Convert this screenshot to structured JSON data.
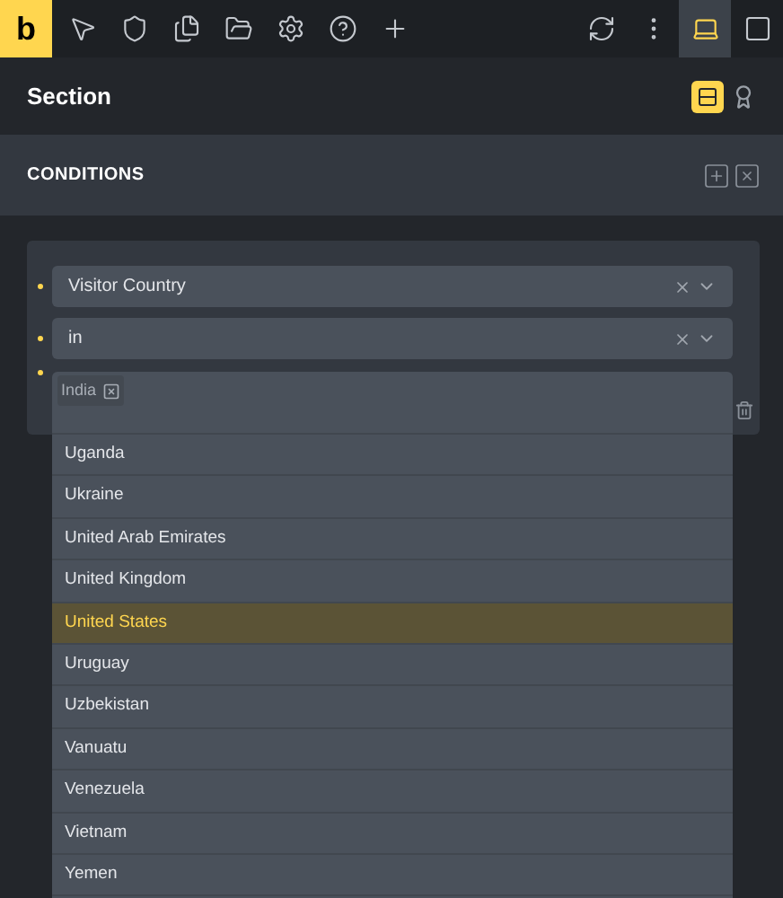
{
  "toolbar": {
    "logo": "b"
  },
  "panel": {
    "title": "Section"
  },
  "conditions": {
    "title": "CONDITIONS"
  },
  "fields": [
    {
      "value": "Visitor Country"
    },
    {
      "value": "in"
    }
  ],
  "tags": [
    "India"
  ],
  "options": [
    {
      "label": "Uganda",
      "selected": false
    },
    {
      "label": "Ukraine",
      "selected": false
    },
    {
      "label": "United Arab Emirates",
      "selected": false
    },
    {
      "label": "United Kingdom",
      "selected": false
    },
    {
      "label": "United States",
      "selected": true
    },
    {
      "label": "Uruguay",
      "selected": false
    },
    {
      "label": "Uzbekistan",
      "selected": false
    },
    {
      "label": "Vanuatu",
      "selected": false
    },
    {
      "label": "Venezuela",
      "selected": false
    },
    {
      "label": "Vietnam",
      "selected": false
    },
    {
      "label": "Yemen",
      "selected": false
    }
  ]
}
